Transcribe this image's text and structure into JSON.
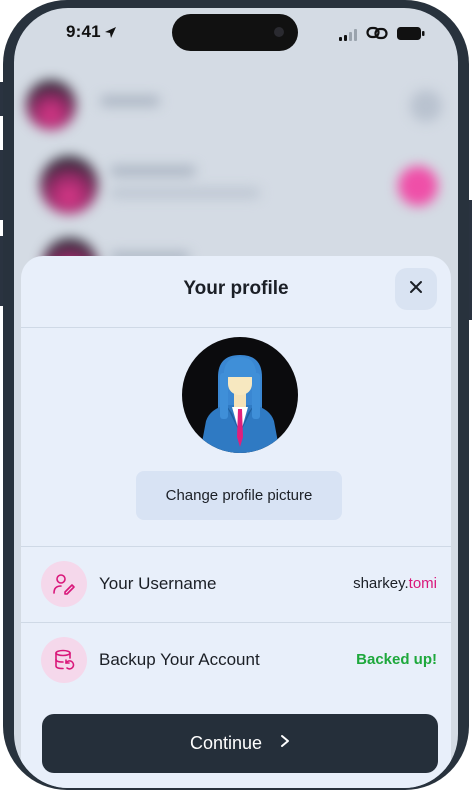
{
  "status_bar": {
    "time": "9:41",
    "icons": [
      "location-arrow-icon",
      "signal-icon",
      "link-icon",
      "battery-icon"
    ]
  },
  "sheet": {
    "title": "Your profile",
    "close_icon": "close-icon",
    "change_picture_label": "Change profile picture"
  },
  "rows": {
    "username": {
      "label": "Your Username",
      "value_prefix": "sharkey.",
      "value_accent": "tomi",
      "icon": "user-edit-icon"
    },
    "backup": {
      "label": "Backup Your Account",
      "status": "Backed up!",
      "icon": "database-restore-icon"
    }
  },
  "continue_button": {
    "label": "Continue",
    "icon": "chevron-right-icon"
  },
  "colors": {
    "accent": "#d9177a",
    "success": "#1ea83c",
    "button_dark": "#252f3a",
    "sheet_bg": "#e8effa"
  }
}
